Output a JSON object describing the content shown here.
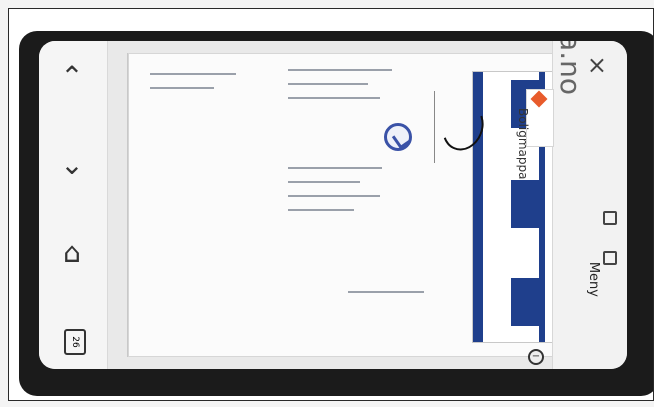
{
  "browser": {
    "url": "ter.boligmappa.no",
    "menu_label": "Meny",
    "brand_name": "Boligmappa",
    "tabs_count": "26"
  },
  "icons": {
    "close": "close-icon",
    "back": "chevron-up-icon",
    "down": "chevron-down-icon",
    "home": "home-icon",
    "zoom": "zoom-out-icon"
  },
  "colors": {
    "accent_blue": "#1f3f8c",
    "brand_orange": "#e85b2b",
    "frame_dark": "#1b1b1b"
  }
}
